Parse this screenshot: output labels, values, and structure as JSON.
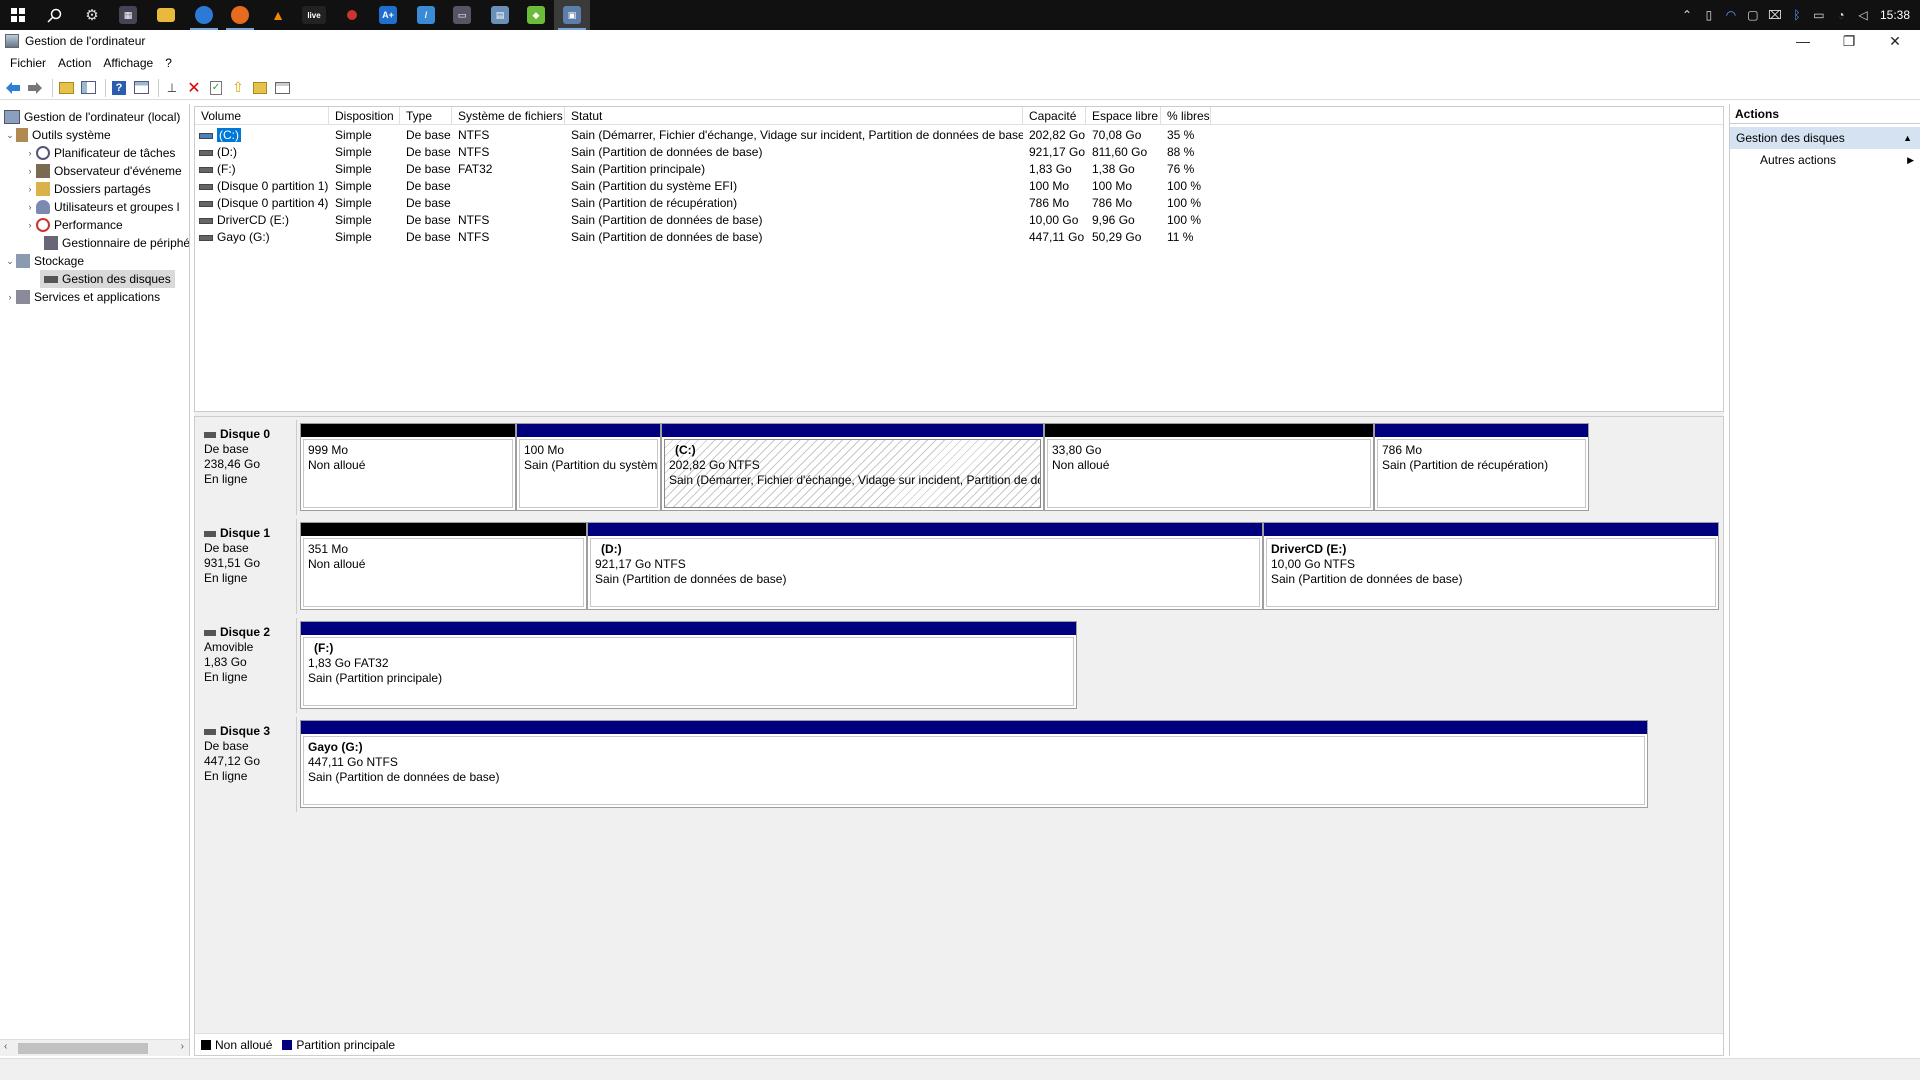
{
  "window": {
    "title": "Gestion de l'ordinateur",
    "clock": "15:38"
  },
  "menu": [
    "Fichier",
    "Action",
    "Affichage",
    "?"
  ],
  "tree": {
    "root": "Gestion de l'ordinateur (local)",
    "system_tools": "Outils système",
    "task_scheduler": "Planificateur de tâches",
    "event_viewer": "Observateur d'événeme",
    "shared_folders": "Dossiers partagés",
    "users_groups": "Utilisateurs et groupes l",
    "performance": "Performance",
    "device_manager": "Gestionnaire de périphé",
    "storage": "Stockage",
    "disk_management": "Gestion des disques",
    "services_apps": "Services et applications"
  },
  "volume_table": {
    "headers": [
      "Volume",
      "Disposition",
      "Type",
      "Système de fichiers",
      "Statut",
      "Capacité",
      "Espace libre",
      "% libres"
    ],
    "rows": [
      [
        "(C:)",
        "Simple",
        "De base",
        "NTFS",
        "Sain (Démarrer, Fichier d'échange, Vidage sur incident, Partition de données de base)",
        "202,82 Go",
        "70,08 Go",
        "35 %"
      ],
      [
        "(D:)",
        "Simple",
        "De base",
        "NTFS",
        "Sain (Partition de données de base)",
        "921,17 Go",
        "811,60 Go",
        "88 %"
      ],
      [
        "(F:)",
        "Simple",
        "De base",
        "FAT32",
        "Sain (Partition principale)",
        "1,83 Go",
        "1,38 Go",
        "76 %"
      ],
      [
        "(Disque 0 partition 1)",
        "Simple",
        "De base",
        "",
        "Sain (Partition du système EFI)",
        "100 Mo",
        "100 Mo",
        "100 %"
      ],
      [
        "(Disque 0 partition 4)",
        "Simple",
        "De base",
        "",
        "Sain (Partition de récupération)",
        "786 Mo",
        "786 Mo",
        "100 %"
      ],
      [
        "DriverCD (E:)",
        "Simple",
        "De base",
        "NTFS",
        "Sain (Partition de données de base)",
        "10,00 Go",
        "9,96 Go",
        "100 %"
      ],
      [
        "Gayo (G:)",
        "Simple",
        "De base",
        "NTFS",
        "Sain (Partition de données de base)",
        "447,11 Go",
        "50,29 Go",
        "11 %"
      ]
    ]
  },
  "disks": [
    {
      "name": "Disque 0",
      "type": "De base",
      "size": "238,46 Go",
      "state": "En ligne",
      "partitions": [
        {
          "kind": "unallocated",
          "title": "",
          "line1": "999 Mo",
          "line2": "Non alloué"
        },
        {
          "kind": "primary",
          "title": "",
          "line1": "100 Mo",
          "line2": "Sain (Partition du systèm"
        },
        {
          "kind": "primary",
          "title": "(C:)",
          "line1": "202,82 Go NTFS",
          "line2": "Sain (Démarrer, Fichier d'échange, Vidage sur incident, Partition de do",
          "selected": true
        },
        {
          "kind": "unallocated",
          "title": "",
          "line1": "33,80 Go",
          "line2": "Non alloué"
        },
        {
          "kind": "primary",
          "title": "",
          "line1": "786 Mo",
          "line2": "Sain (Partition de récupération)"
        }
      ]
    },
    {
      "name": "Disque 1",
      "type": "De base",
      "size": "931,51 Go",
      "state": "En ligne",
      "partitions": [
        {
          "kind": "unallocated",
          "title": "",
          "line1": "351 Mo",
          "line2": "Non alloué"
        },
        {
          "kind": "primary",
          "title": "(D:)",
          "line1": "921,17 Go NTFS",
          "line2": "Sain (Partition de données de base)"
        },
        {
          "kind": "primary",
          "title": "DriverCD  (E:)",
          "line1": "10,00 Go NTFS",
          "line2": "Sain (Partition de données de base)"
        }
      ]
    },
    {
      "name": "Disque 2",
      "type": "Amovible",
      "size": "1,83 Go",
      "state": "En ligne",
      "partitions": [
        {
          "kind": "primary",
          "title": "(F:)",
          "line1": "1,83 Go FAT32",
          "line2": "Sain (Partition principale)"
        }
      ]
    },
    {
      "name": "Disque 3",
      "type": "De base",
      "size": "447,12 Go",
      "state": "En ligne",
      "partitions": [
        {
          "kind": "primary",
          "title": "Gayo  (G:)",
          "line1": "447,11 Go NTFS",
          "line2": "Sain (Partition de données de base)"
        }
      ]
    }
  ],
  "legend": {
    "unallocated": "Non alloué",
    "primary": "Partition principale",
    "unallocated_color": "#000000",
    "primary_color": "#00007f"
  },
  "actions": {
    "header": "Actions",
    "section": "Gestion des disques",
    "more": "Autres actions"
  },
  "icons": {
    "start": "windows-logo-icon",
    "search": "search-icon",
    "settings": "gear-icon"
  }
}
